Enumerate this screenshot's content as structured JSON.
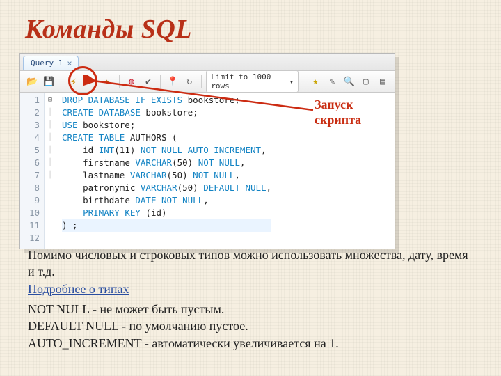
{
  "title": "Команды SQL",
  "tab": {
    "label": "Query 1"
  },
  "toolbar": {
    "limit_label": "Limit to 1000 rows"
  },
  "callout": {
    "line1": "Запуск",
    "line2": "скрипта"
  },
  "code": {
    "lines": [
      {
        "n": 1,
        "fold": "",
        "pre": "",
        "kw": "DROP DATABASE IF EXISTS",
        "rest": " bookstore;"
      },
      {
        "n": 2,
        "fold": "",
        "pre": "",
        "kw": "CREATE DATABASE",
        "rest": " bookstore;"
      },
      {
        "n": 3,
        "fold": "",
        "pre": "",
        "kw": "USE",
        "rest": " bookstore;"
      },
      {
        "n": 4,
        "fold": "",
        "pre": "",
        "kw": "",
        "rest": ""
      },
      {
        "n": 5,
        "fold": "⊟",
        "pre": "",
        "kw": "CREATE TABLE",
        "rest": " AUTHORS ("
      },
      {
        "n": 6,
        "fold": "│",
        "pre": "    ",
        "kw": "",
        "rest": "id INT(11) NOT NULL AUTO_INCREMENT,",
        "hl": [
          "INT",
          "NOT NULL",
          "AUTO_INCREMENT"
        ]
      },
      {
        "n": 7,
        "fold": "│",
        "pre": "    ",
        "kw": "",
        "rest": "firstname VARCHAR(50) NOT NULL,",
        "hl": [
          "VARCHAR",
          "NOT NULL"
        ]
      },
      {
        "n": 8,
        "fold": "│",
        "pre": "    ",
        "kw": "",
        "rest": "lastname VARCHAR(50) NOT NULL,",
        "hl": [
          "VARCHAR",
          "NOT NULL"
        ]
      },
      {
        "n": 9,
        "fold": "│",
        "pre": "    ",
        "kw": "",
        "rest": "patronymic VARCHAR(50) DEFAULT NULL,",
        "hl": [
          "VARCHAR",
          "DEFAULT NULL"
        ]
      },
      {
        "n": 10,
        "fold": "│",
        "pre": "    ",
        "kw": "",
        "rest": "birthdate DATE NOT NULL,",
        "hl": [
          "DATE",
          "NOT NULL"
        ]
      },
      {
        "n": 11,
        "fold": "│",
        "pre": "    ",
        "kw": "PRIMARY KEY",
        "rest": " (id)"
      },
      {
        "n": 12,
        "fold": "",
        "pre": "",
        "kw": "",
        "rest": ") ;",
        "caret": true
      }
    ]
  },
  "paragraph1": "Помимо числовых и строковых типов можно использовать множества, дату, время и т.д.",
  "link_text": "Подробнее о типах",
  "paragraph2_l1": "NOT NULL - не может быть пустым.",
  "paragraph2_l2": "DEFAULT NULL - по умолчанию пустое.",
  "paragraph2_l3": "AUTO_INCREMENT - автоматически увеличивается на 1."
}
